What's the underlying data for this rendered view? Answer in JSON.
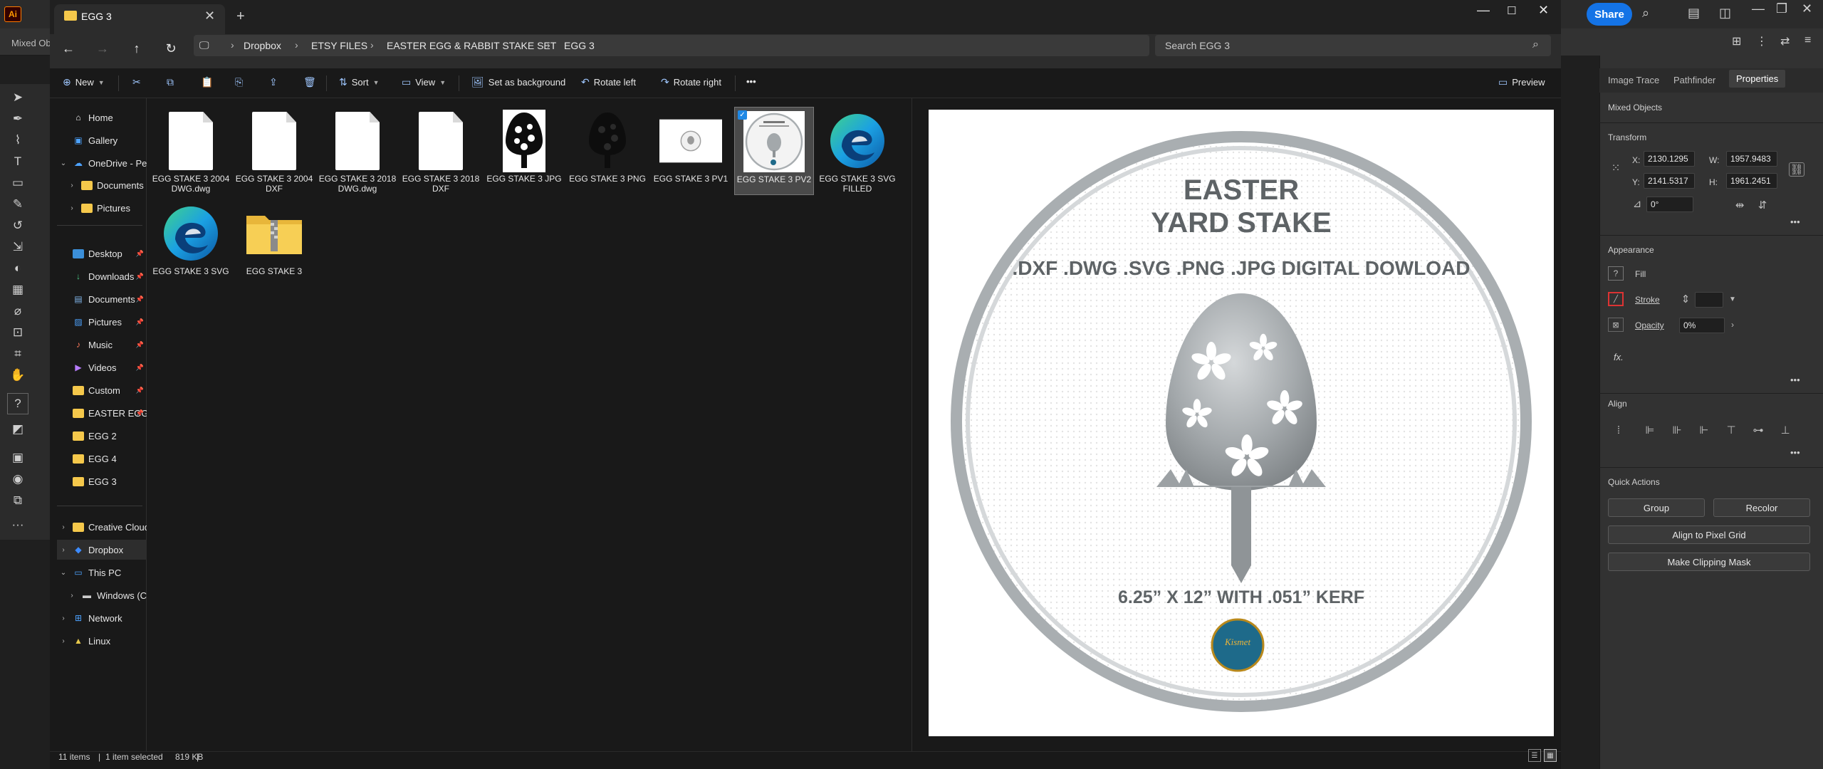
{
  "illustrator": {
    "logo": "Ai",
    "control_bar_text": "Mixed Ob",
    "share_label": "Share",
    "properties": {
      "tabs": [
        "Image Trace",
        "Pathfinder",
        "Properties"
      ],
      "active_tab": "Properties",
      "selection_type": "Mixed Objects",
      "transform_label": "Transform",
      "x_label": "X:",
      "x_value": "2130.1295",
      "y_label": "Y:",
      "y_value": "2141.5317",
      "w_label": "W:",
      "w_value": "1957.9483",
      "h_label": "H:",
      "h_value": "1961.2451",
      "angle_value": "0°",
      "appearance_label": "Appearance",
      "fill_label": "Fill",
      "stroke_label": "Stroke",
      "opacity_label": "Opacity",
      "opacity_value": "0%",
      "fx_label": "fx.",
      "align_label": "Align",
      "quick_actions_label": "Quick Actions",
      "group_label": "Group",
      "recolor_label": "Recolor",
      "align_pixel_label": "Align to Pixel Grid",
      "clip_mask_label": "Make Clipping Mask",
      "more": "•••"
    }
  },
  "explorer": {
    "tab_title": "EGG 3",
    "breadcrumb": [
      "Dropbox",
      "ETSY FILES",
      "EASTER EGG & RABBIT STAKE SET",
      "EGG 3"
    ],
    "search_placeholder": "Search EGG 3",
    "commands": {
      "new": "New",
      "sort": "Sort",
      "view": "View",
      "set_background": "Set as background",
      "rotate_left": "Rotate left",
      "rotate_right": "Rotate right",
      "more": "•••",
      "preview": "Preview"
    },
    "nav": [
      {
        "label": "Home"
      },
      {
        "label": "Gallery"
      },
      {
        "label": "OneDrive - Pers"
      },
      {
        "label": "Documents"
      },
      {
        "label": "Pictures"
      },
      {
        "label": "Desktop"
      },
      {
        "label": "Downloads"
      },
      {
        "label": "Documents"
      },
      {
        "label": "Pictures"
      },
      {
        "label": "Music"
      },
      {
        "label": "Videos"
      },
      {
        "label": "Custom"
      },
      {
        "label": "EASTER EGG"
      },
      {
        "label": "EGG 2"
      },
      {
        "label": "EGG 4"
      },
      {
        "label": "EGG 3"
      },
      {
        "label": "Creative Cloud"
      },
      {
        "label": "Dropbox"
      },
      {
        "label": "This PC"
      },
      {
        "label": "Windows (C:)"
      },
      {
        "label": "Network"
      },
      {
        "label": "Linux"
      }
    ],
    "files": [
      {
        "name": "EGG STAKE 3 2004 DWG.dwg",
        "kind": "doc"
      },
      {
        "name": "EGG STAKE 3 2004 DXF",
        "kind": "doc"
      },
      {
        "name": "EGG STAKE 3 2018 DWG.dwg",
        "kind": "doc"
      },
      {
        "name": "EGG STAKE 3 2018 DXF",
        "kind": "doc"
      },
      {
        "name": "EGG STAKE 3 JPG",
        "kind": "jpg"
      },
      {
        "name": "EGG STAKE 3 PNG",
        "kind": "png"
      },
      {
        "name": "EGG STAKE 3 PV1",
        "kind": "pv1"
      },
      {
        "name": "EGG STAKE 3 PV2",
        "kind": "pv2"
      },
      {
        "name": "EGG STAKE 3 SVG FILLED",
        "kind": "edge"
      },
      {
        "name": "EGG STAKE 3 SVG",
        "kind": "edge"
      },
      {
        "name": "EGG STAKE 3",
        "kind": "zip"
      }
    ],
    "preview": {
      "line1": "EASTER",
      "line2": "YARD STAKE",
      "formats": ".DXF .DWG .SVG .PNG .JPG DIGITAL DOWLOAD",
      "size": "6.25” X 12” WITH .051” KERF",
      "logo_text": "Kismet"
    },
    "status": {
      "items": "11 items",
      "selected": "1 item selected",
      "size": "819 KB"
    }
  }
}
